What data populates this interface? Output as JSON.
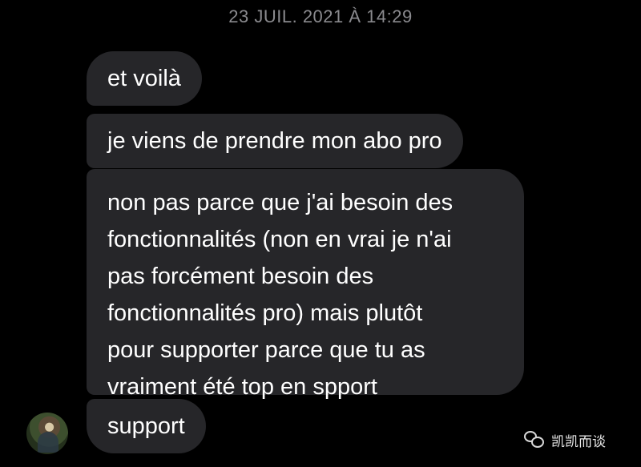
{
  "conversation": {
    "timestamp": "23 JUIL. 2021 À 14:29",
    "messages": [
      {
        "text": "et voilà"
      },
      {
        "text": "je viens de prendre mon abo pro"
      },
      {
        "lines": [
          "non pas parce que j'ai besoin des",
          "fonctionnalités (non en vrai je n'ai",
          "pas forcément besoin des",
          "fonctionnalités pro) mais plutôt",
          "pour supporter parce que tu as",
          "vraiment été top en spport"
        ]
      },
      {
        "text": "support"
      }
    ]
  },
  "watermark": {
    "text": "凯凯而谈",
    "icon": "wechat-icon"
  },
  "colors": {
    "background": "#000000",
    "bubble": "#262629",
    "timestamp": "#8a8a8e",
    "text": "#ffffff"
  }
}
